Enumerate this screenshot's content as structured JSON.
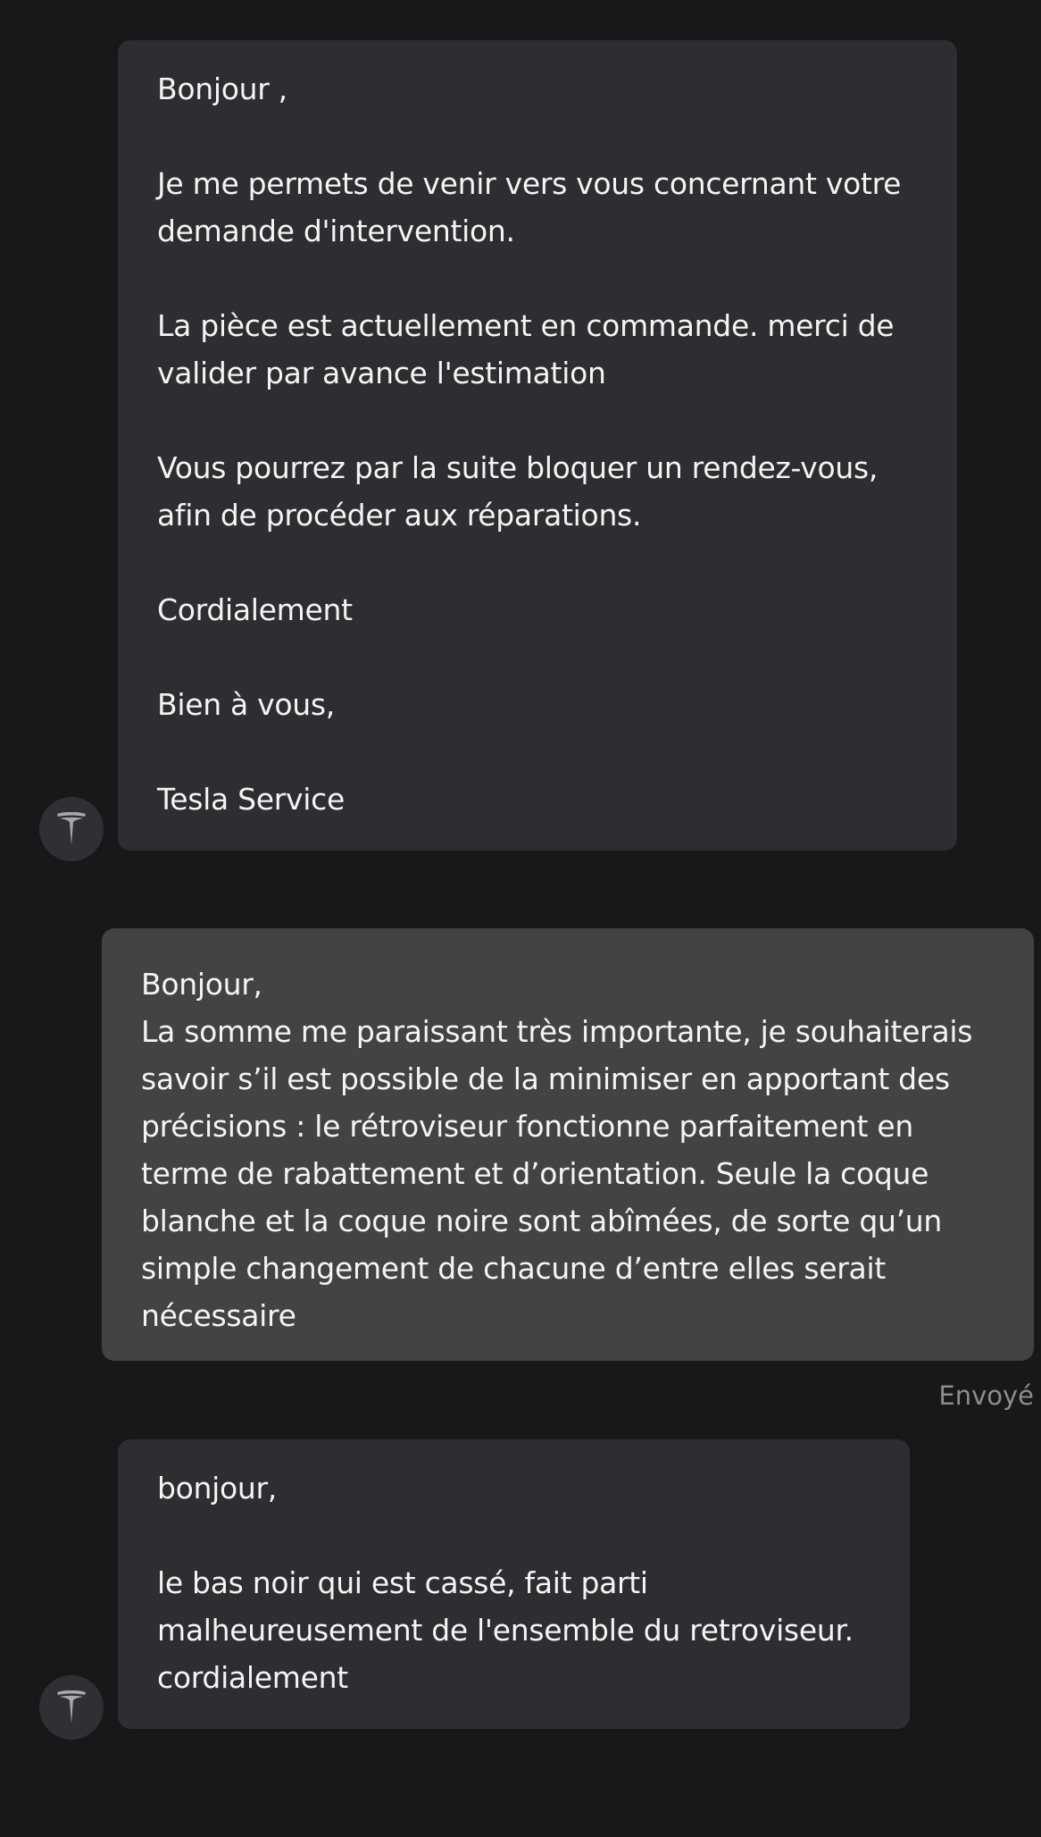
{
  "conversation": {
    "messages": [
      {
        "sender": "Tesla Service",
        "direction": "incoming",
        "text": "Bonjour ,\n\nJe me permets de venir vers vous concernant votre demande d'intervention.\n\nLa pièce est actuellement en commande. merci de valider par avance l'estimation\n\nVous pourrez par la suite bloquer un rendez-vous, afin de procéder aux réparations.\n\nCordialement\n\nBien à vous,\n\nTesla Service"
      },
      {
        "direction": "outgoing",
        "text": "Bonjour,\nLa somme me paraissant très importante, je souhaiterais savoir s’il est possible de la minimiser en apportant des précisions : le rétroviseur fonctionne parfaitement en terme de rabattement et d’orientation. Seule la coque blanche et la coque noire sont abîmées, de sorte qu’un simple changement de chacune d’entre elles serait nécessaire",
        "status": "Envoyé"
      },
      {
        "direction": "incoming",
        "text": "bonjour,\n\nle bas noir qui est cassé, fait parti malheureusement de l'ensemble du retroviseur.\ncordialement"
      }
    ]
  },
  "icons": {
    "avatar": "tesla-logo-icon"
  },
  "colors": {
    "background": "#18181b",
    "incoming_bubble": "#2d2d32",
    "outgoing_bubble": "#434343",
    "status_text": "#8c8c90",
    "avatar_bg": "#303034",
    "logo": "#a9a9ad"
  }
}
